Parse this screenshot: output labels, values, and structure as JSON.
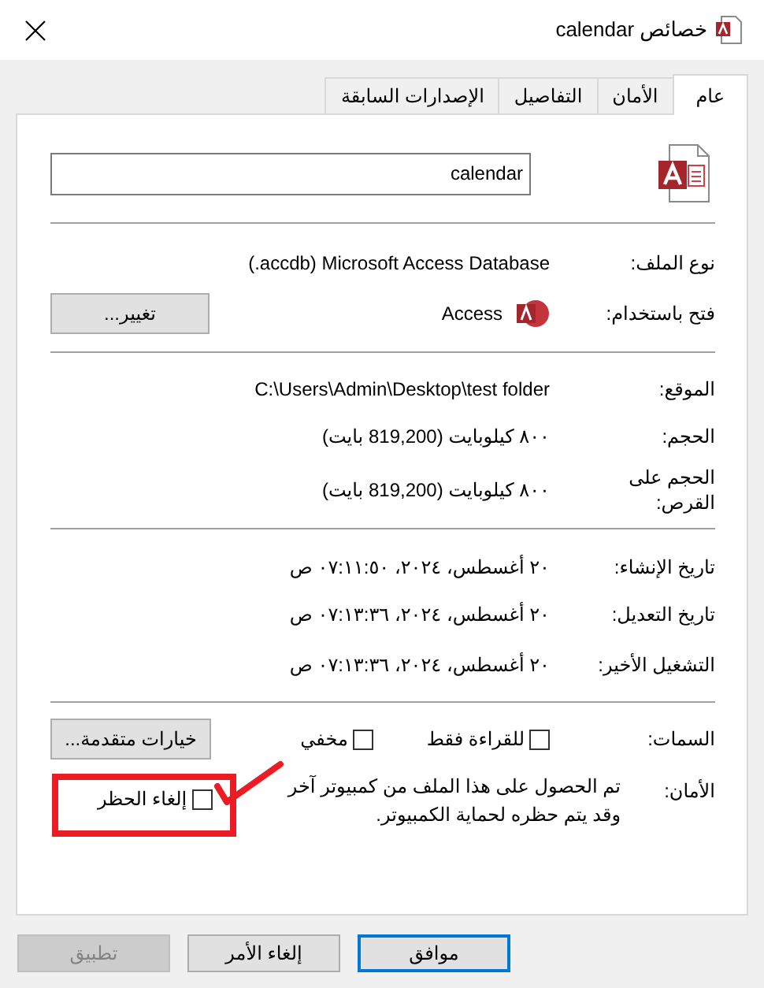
{
  "window": {
    "title": "خصائص calendar"
  },
  "tabs": [
    {
      "label": "عام",
      "selected": true
    },
    {
      "label": "الأمان",
      "selected": false
    },
    {
      "label": "التفاصيل",
      "selected": false
    },
    {
      "label": "الإصدارات السابقة",
      "selected": false
    }
  ],
  "name_field": {
    "value": "calendar"
  },
  "file_type": {
    "label": "نوع الملف:",
    "value": "(.accdb) Microsoft Access Database"
  },
  "open_with": {
    "label": "فتح باستخدام:",
    "app": "Access",
    "button": "تغيير..."
  },
  "location": {
    "label": "الموقع:",
    "value": "C:\\Users\\Admin\\Desktop\\test folder"
  },
  "size": {
    "label": "الحجم:",
    "value": "٨٠٠ كيلوبايت (819,200 بايت)"
  },
  "size_on_disk": {
    "label": "الحجم على القرص:",
    "value": "٨٠٠ كيلوبايت (819,200 بايت)"
  },
  "dates": [
    {
      "label": "تاريخ الإنشاء:",
      "value": "٢٠ أغسطس، ٢٠٢٤، ٠٧:١١:٥٠ ص"
    },
    {
      "label": "تاريخ التعديل:",
      "value": "٢٠ أغسطس، ٢٠٢٤، ٠٧:١٣:٣٦ ص"
    },
    {
      "label": "التشغيل الأخير:",
      "value": "٢٠ أغسطس، ٢٠٢٤، ٠٧:١٣:٣٦ ص"
    }
  ],
  "attributes": {
    "label": "السمات:",
    "checkboxes": [
      {
        "label": "للقراءة فقط",
        "checked": false
      },
      {
        "label": "مخفي",
        "checked": false
      }
    ],
    "button": "خيارات متقدمة..."
  },
  "security": {
    "label": "الأمان:",
    "message": "تم الحصول على هذا الملف من كمبيوتر آخر وقد يتم حظره لحماية الكمبيوتر.",
    "unblock": {
      "label": "إلغاء الحظر",
      "checked": false
    }
  },
  "buttons": [
    {
      "label": "موافق",
      "kind": "default",
      "disabled": false
    },
    {
      "label": "إلغاء الأمر",
      "kind": "normal",
      "disabled": false
    },
    {
      "label": "تطبيق",
      "kind": "normal",
      "disabled": true
    }
  ]
}
